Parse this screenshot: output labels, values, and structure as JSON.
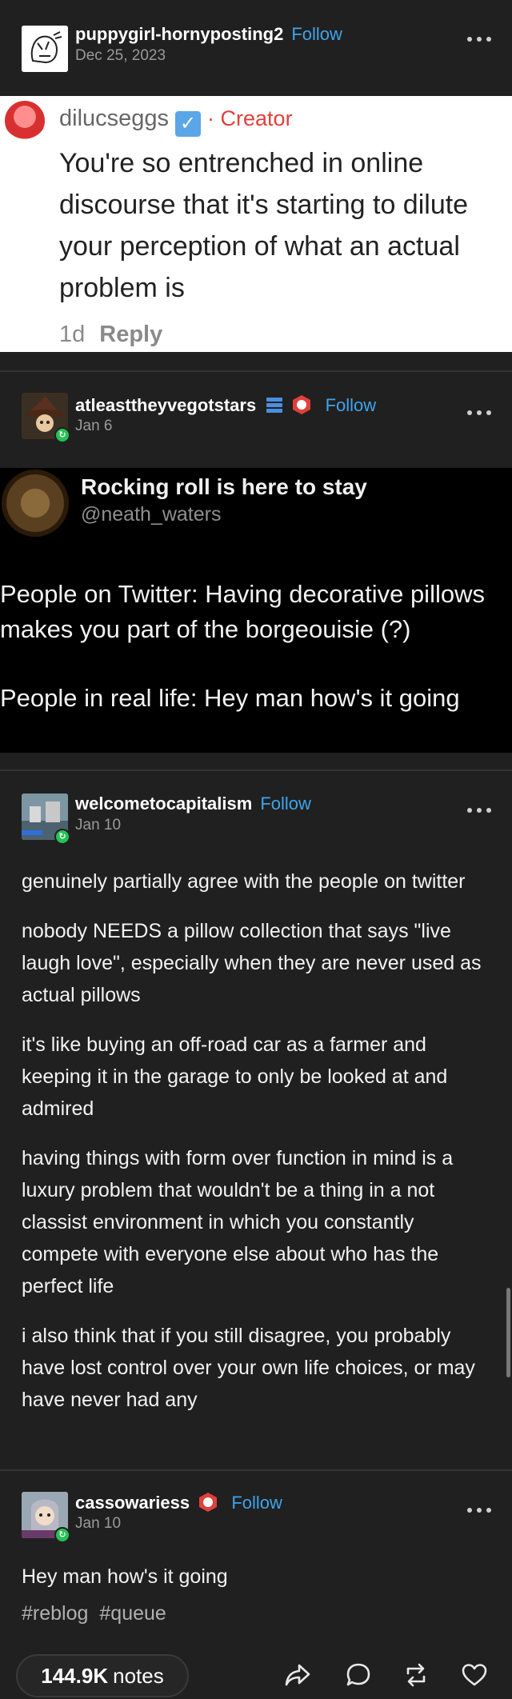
{
  "post1": {
    "username": "puppygirl-hornyposting2",
    "follow": "Follow",
    "date": "Dec 25, 2023",
    "screenshot": {
      "username": "dilucseggs",
      "verified_glyph": "✓",
      "creator": "· Creator",
      "body": "You're so entrenched in online discourse that it's starting to dilute your perception of what an actual problem is",
      "age": "1d",
      "reply": "Reply"
    }
  },
  "post2": {
    "username": "atleasttheyvegotstars",
    "follow": "Follow",
    "date": "Jan 6",
    "screenshot": {
      "display_name": "Rocking roll is here to stay",
      "handle": "@neath_waters",
      "line1": "People on Twitter: Having decorative pillows makes you part of the borgeouisie (?)",
      "line2": "People in real life: Hey man how's it going"
    }
  },
  "post3": {
    "username": "welcometocapitalism",
    "follow": "Follow",
    "date": "Jan 10",
    "paragraphs": [
      "genuinely partially agree with the people on twitter",
      "nobody NEEDS a pillow collection that says \"live laugh love\", especially when they are never used as actual pillows",
      "it's like buying an off-road car as a farmer and keeping it in the garage to only be looked at and admired",
      "having things with form over function in mind is a luxury problem that wouldn't be a thing in a not classist environment in which you constantly compete with everyone else about who has the perfect life",
      "i also think that if you still disagree, you probably have lost control over your own life choices, or may have never had any"
    ]
  },
  "post4": {
    "username": "cassowariess",
    "follow": "Follow",
    "date": "Jan 10",
    "body": "Hey man how's it going",
    "tags": [
      "#reblog",
      "#queue"
    ]
  },
  "footer": {
    "notes_count": "144.9K",
    "notes_label": "notes"
  },
  "colors": {
    "background": "#202020",
    "follow": "#3ea4ec",
    "creator": "#e0403c",
    "reblog_badge": "#24c353"
  }
}
